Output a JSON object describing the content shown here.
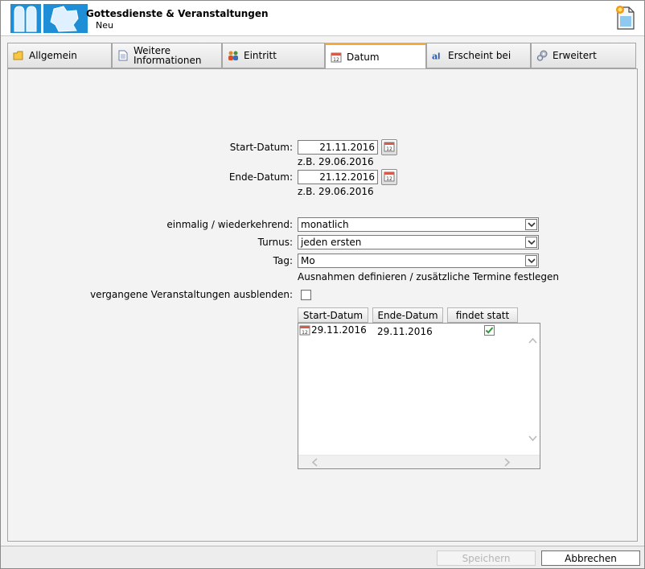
{
  "header": {
    "title": "Gottesdienste & Veranstaltungen",
    "subtitle": "Neu"
  },
  "tabs": [
    {
      "label": "Allgemein",
      "icon": "folder-icon"
    },
    {
      "label": "Weitere Informationen",
      "icon": "document-icon"
    },
    {
      "label": "Eintritt",
      "icon": "people-icon"
    },
    {
      "label": "Datum",
      "icon": "calendar-icon",
      "active": true
    },
    {
      "label": "Erscheint bei",
      "icon": "font-icon"
    },
    {
      "label": "Erweitert",
      "icon": "gears-icon"
    }
  ],
  "form": {
    "start_label": "Start-Datum:",
    "start_value": "21.11.2016",
    "start_hint": "z.B. 29.06.2016",
    "end_label": "Ende-Datum:",
    "end_value": "21.12.2016",
    "end_hint": "z.B. 29.06.2016",
    "recurrence_label": "einmalig / wiederkehrend:",
    "recurrence_value": "monatlich",
    "turnus_label": "Turnus:",
    "turnus_value": "jeden ersten",
    "tag_label": "Tag:",
    "tag_value": "Mo",
    "exceptions_link": "Ausnahmen definieren / zusätzliche Termine festlegen",
    "hide_past_label": "vergangene Veranstaltungen ausblenden:",
    "hide_past_checked": false
  },
  "table": {
    "columns": [
      "Start-Datum",
      "Ende-Datum",
      "findet statt"
    ],
    "rows": [
      {
        "start": "29.11.2016",
        "end": "29.11.2016",
        "takes_place": true
      }
    ]
  },
  "footer": {
    "save_label": "Speichern",
    "cancel_label": "Abbrechen"
  },
  "colors": {
    "active_tab_accent": "#f3a93b",
    "logo_blue": "#1e8fd6"
  }
}
